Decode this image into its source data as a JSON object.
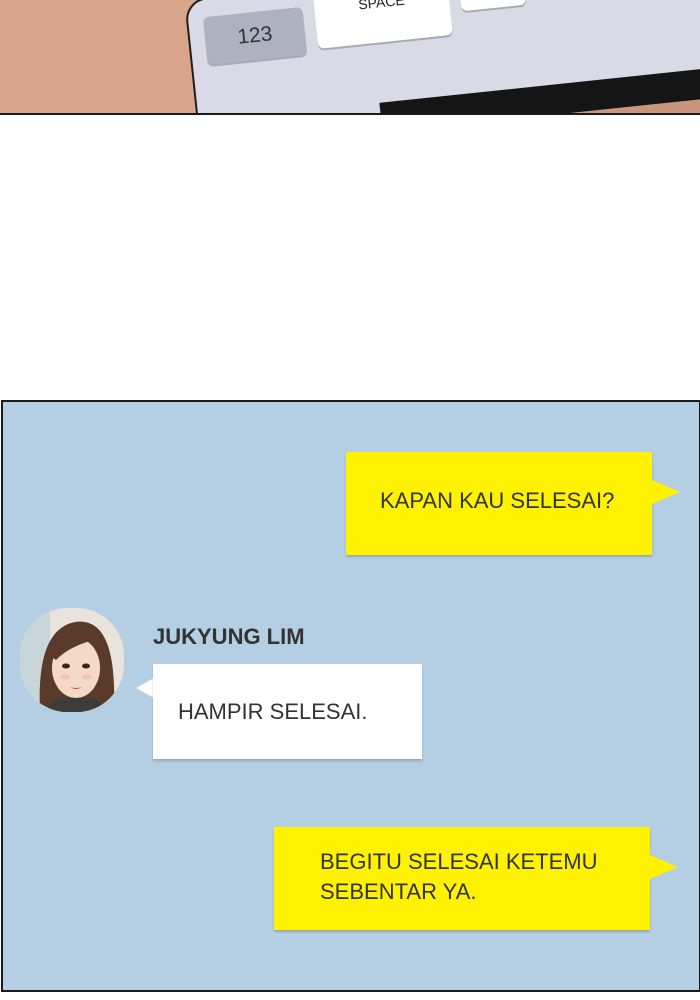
{
  "keyboard": {
    "key_123": "123",
    "key_space": "SPACE"
  },
  "chat": {
    "messages": [
      {
        "from": "me",
        "text": "KAPAN KAU SELESAI?"
      },
      {
        "from": "other",
        "sender": "JUKYUNG LIM",
        "text": "HAMPIR SELESAI."
      },
      {
        "from": "me",
        "lines": [
          "BEGITU SELESAI KETEMU",
          "SEBENTAR YA."
        ]
      }
    ]
  },
  "colors": {
    "chat_background": "#b4cee3",
    "my_bubble": "#fff200",
    "their_bubble": "#ffffff",
    "text": "#333333"
  },
  "icons": {
    "avatar": "avatar-portrait"
  }
}
